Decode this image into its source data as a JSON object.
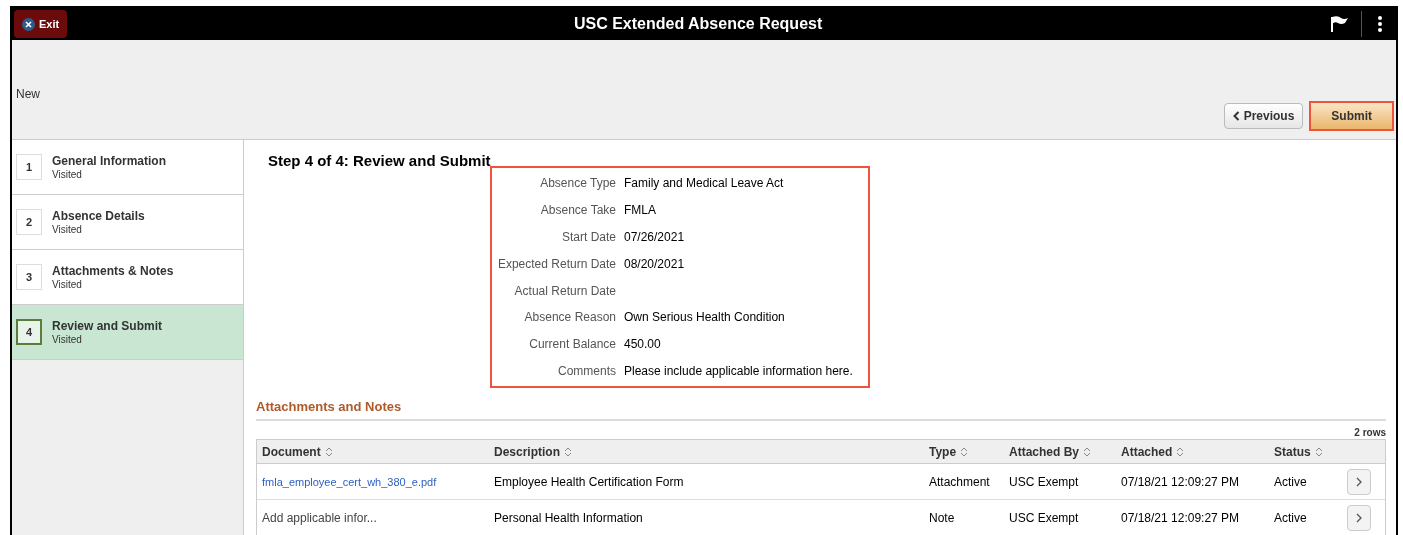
{
  "header": {
    "exit_label": "Exit",
    "title": "USC Extended Absence Request"
  },
  "toolbar": {
    "status": "New",
    "previous_label": "Previous",
    "submit_label": "Submit"
  },
  "steps": [
    {
      "number": "1",
      "title": "General Information",
      "status": "Visited",
      "selected": false
    },
    {
      "number": "2",
      "title": "Absence Details",
      "status": "Visited",
      "selected": false
    },
    {
      "number": "3",
      "title": "Attachments & Notes",
      "status": "Visited",
      "selected": false
    },
    {
      "number": "4",
      "title": "Review and Submit",
      "status": "Visited",
      "selected": true
    }
  ],
  "page_title": "Step 4 of 4: Review and Submit",
  "summary": [
    {
      "label": "Absence Type",
      "value": "Family and Medical Leave Act"
    },
    {
      "label": "Absence Take",
      "value": "FMLA"
    },
    {
      "label": "Start Date",
      "value": "07/26/2021"
    },
    {
      "label": "Expected Return Date",
      "value": "08/20/2021"
    },
    {
      "label": "Actual Return Date"
    },
    {
      "label": "Absence Reason",
      "value": "Own Serious Health Condition"
    },
    {
      "label": "Current Balance",
      "value": "450.00"
    },
    {
      "label": "Comments",
      "value": "Please include applicable information here."
    }
  ],
  "attachments": {
    "title": "Attachments and Notes",
    "row_count": "2 rows",
    "columns": [
      "Document",
      "Description",
      "Type",
      "Attached By",
      "Attached",
      "Status"
    ],
    "rows": [
      {
        "document": {
          "kind": "link",
          "text": "fmla_employee_cert_wh_380_e.pdf"
        },
        "description": "Employee Health Certification Form",
        "type": "Attachment",
        "attached_by": "USC Exempt",
        "attached": "07/18/21 12:09:27 PM",
        "status": "Active"
      },
      {
        "document": {
          "kind": "text",
          "text": "Add applicable infor..."
        },
        "description": "Personal Health Information",
        "type": "Note",
        "attached_by": "USC Exempt",
        "attached": "07/18/21 12:09:27 PM",
        "status": "Active"
      }
    ]
  }
}
